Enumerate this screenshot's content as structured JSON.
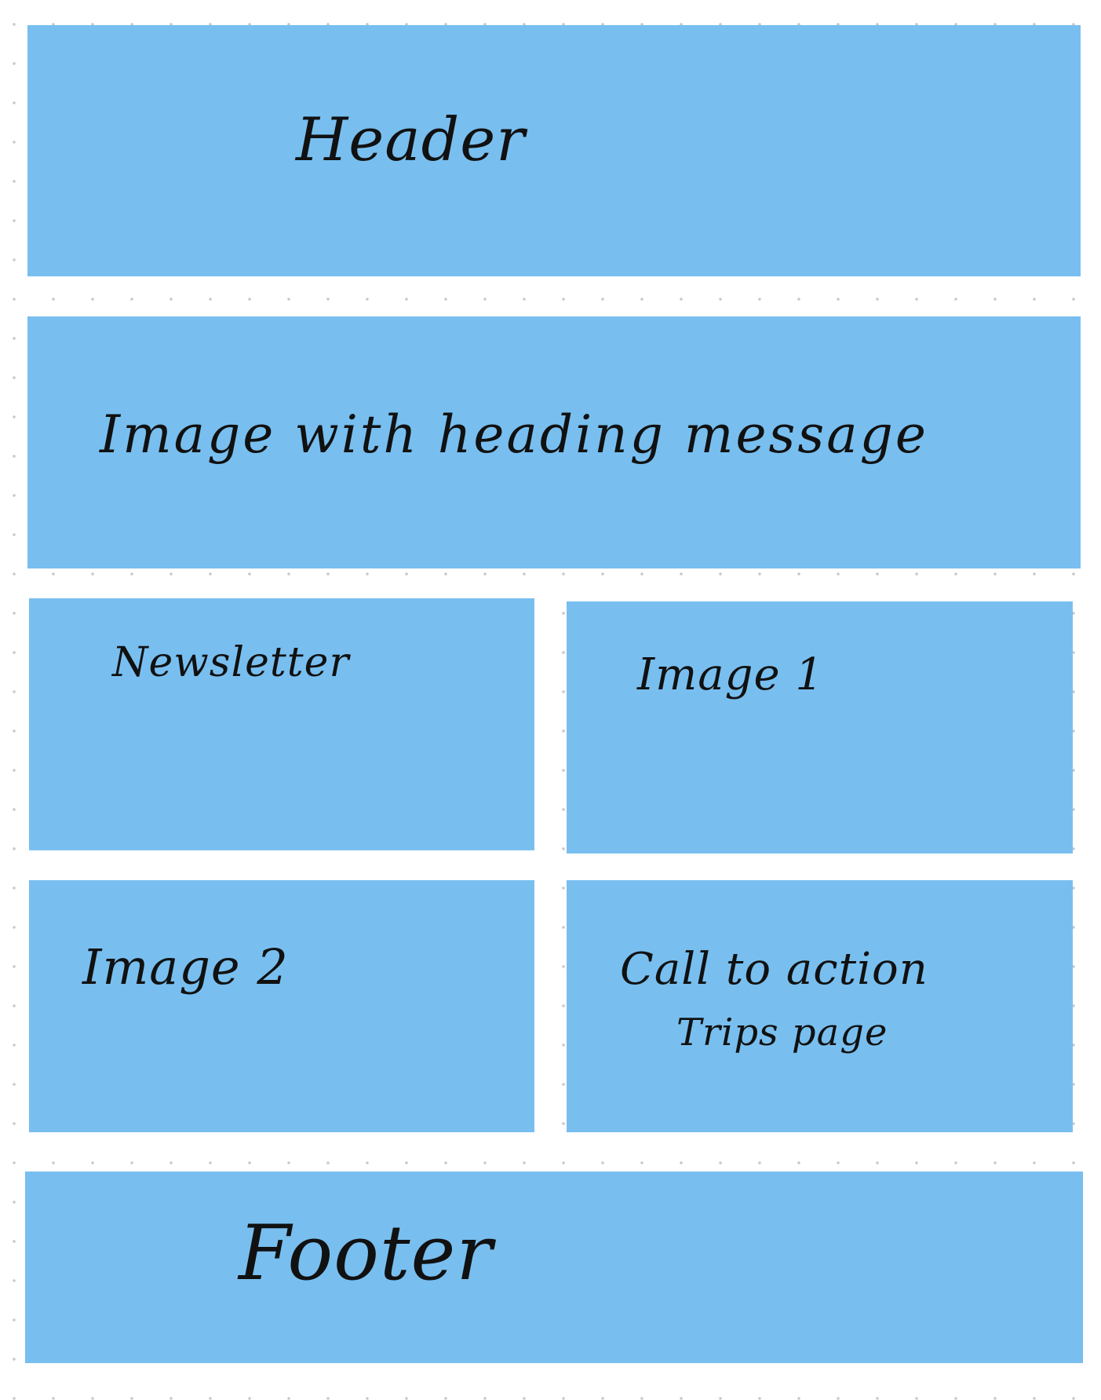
{
  "wireframe": {
    "header": {
      "label": "Header"
    },
    "hero": {
      "label": "Image with heading message"
    },
    "newsletter": {
      "label": "Newsletter"
    },
    "image1": {
      "label": "Image 1"
    },
    "image2": {
      "label": "Image 2"
    },
    "cta": {
      "line1": "Call to action",
      "line2": "Trips page"
    },
    "footer": {
      "label": "Footer"
    }
  },
  "colors": {
    "block_fill": "#78bff0",
    "background": "#ffffff",
    "grid_dots": "#c9c9c9",
    "text": "#111111"
  }
}
